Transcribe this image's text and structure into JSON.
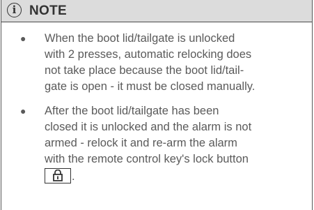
{
  "note": {
    "icon_glyph": "i",
    "icon": "info-icon",
    "title": "NOTE",
    "items": [
      {
        "lines": [
          "When the boot lid/tailgate is unlocked",
          "with 2 presses, automatic relocking does",
          "not take place because the boot lid/tail-",
          "gate is open - it must be closed manually."
        ]
      },
      {
        "lines": [
          "After the boot lid/tailgate has been",
          "closed it is unlocked and the alarm is not",
          "armed - relock it and re-arm the alarm",
          "with the remote control key's lock button"
        ],
        "trailing_icon": "lock-button-icon",
        "trailing_text": "."
      }
    ]
  },
  "colors": {
    "header_bg": "#dcdcdc",
    "text": "#5a5a5a",
    "title": "#333333",
    "border": "#555555"
  }
}
